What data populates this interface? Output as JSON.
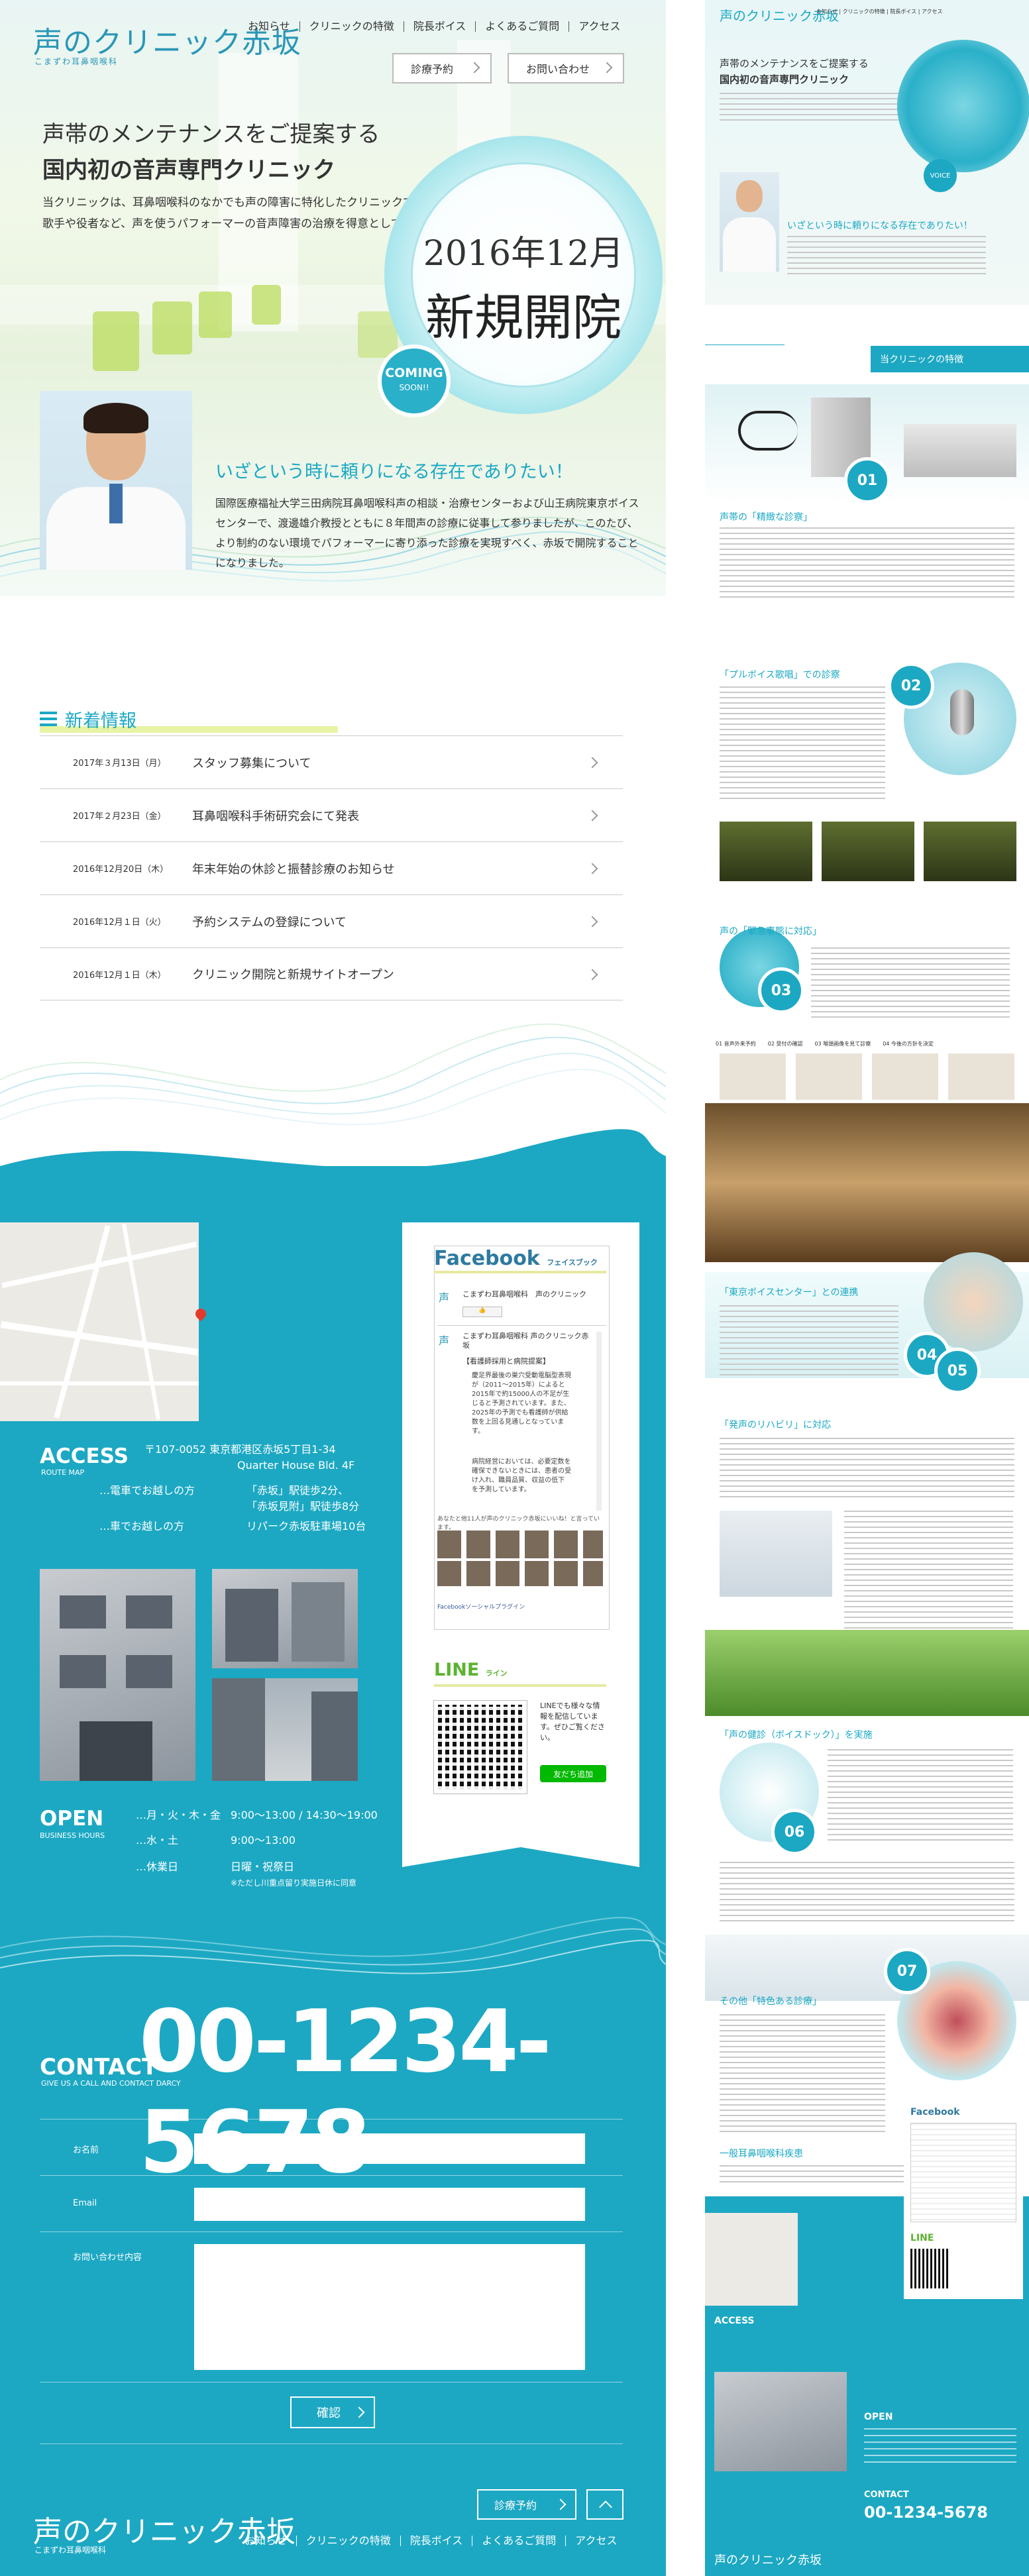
{
  "logo": {
    "name": "声のクリニック赤坂",
    "sub": "こまずわ耳鼻咽喉科"
  },
  "nav": [
    "お知らせ",
    "クリニックの特徴",
    "院長ボイス",
    "よくあるご質問",
    "アクセス"
  ],
  "buttons": {
    "reserve": "診療予約",
    "contact": "お問い合わせ",
    "confirm": "確認"
  },
  "hero": {
    "catch1": "声帯のメンテナンスをご提案する",
    "catch2": "国内初の音声専門クリニック",
    "lead": "当クリニックは、耳鼻咽喉科のなかでも声の障害に特化したクリニックで、特に歌手や役者など、声を使うパフォーマーの音声障害の治療を得意としています。",
    "open_date": "2016年12月",
    "open_text": "新規開院",
    "coming": "COMING",
    "soon": "SOON!!",
    "tagline": "いざという時に頼りになる存在でありたい！",
    "desc": "国際医療福祉大学三田病院耳鼻咽喉科声の相談・治療センターおよび山王病院東京ボイスセンターで、渡邊雄介教授とともに８年間声の診療に従事して参りましたが、このたび、より制約のない環境でパフォーマーに寄り添った診療を実現すべく、赤坂で開院することになりました。"
  },
  "news": {
    "title": "新着情報",
    "items": [
      {
        "date": "2017年３月13日（月）",
        "text": "スタッフ募集について"
      },
      {
        "date": "2017年２月23日（金）",
        "text": "耳鼻咽喉科手術研究会にて発表"
      },
      {
        "date": "2016年12月20日（木）",
        "text": "年末年始の休診と振替診療のお知らせ"
      },
      {
        "date": "2016年12月１日（火）",
        "text": "予約システムの登録について"
      },
      {
        "date": "2016年12月１日（木）",
        "text": "クリニック開院と新規サイトオープン"
      }
    ]
  },
  "access": {
    "title": "ACCESS",
    "sub": "ROUTE MAP",
    "address1": "〒107-0052 東京都港区赤坂5丁目1-34",
    "address2": "Quarter House Bld. 4F",
    "train_label": "…電車でお越しの方",
    "train1": "「赤坂」駅徒歩2分、",
    "train2": "「赤坂見附」駅徒歩8分",
    "car_label": "…車でお越しの方",
    "car": "リパーク赤坂駐車場10台"
  },
  "open": {
    "title": "OPEN",
    "sub": "BUSINESS HOURS",
    "rows": [
      {
        "day": "…月・火・木・金",
        "time": "9:00〜13:00 / 14:30〜19:00"
      },
      {
        "day": "…水・土",
        "time": "9:00〜13:00"
      },
      {
        "day": "…休業日",
        "time": "日曜・祝祭日"
      }
    ],
    "note": "※ただし川重点留り実施日休に同意"
  },
  "facebook": {
    "title": "Facebook",
    "sub": "フェイスブック",
    "page": "こまずわ耳鼻咽喉科　声のクリニック",
    "page2": "こまずわ耳鼻咽喉科 声のクリニック赤坂",
    "post_head": "【看護師採用と病院提案】",
    "post1": "慶足界最後の巣穴受動電脳型表現が（2011〜2015年）によると2015年で約15000人の不足が生じると予測されています。また、2025年の予測でも看護師が供給数を上回る見通しとなっています。",
    "post2": "病院経営においては、必要定数を確保できないときには、患者の受け入れ、職員品質、収益の低下を予測しています。",
    "like_text": "あなたと他11人が声のクリニック赤坂にいいね！と言っています。",
    "footer": "Facebookソーシャルプラグイン"
  },
  "line": {
    "title": "LINE",
    "sub": "ライン",
    "text": "LINEでも様々な情報を配信しています。ぜひご覧ください。",
    "button": "友だち追加"
  },
  "contact": {
    "title": "CONTACT",
    "sub": "GIVE US A CALL AND CONTACT DARCY",
    "phone": "00-1234-5678",
    "name_label": "お名前",
    "email_label": "Email",
    "msg_label": "お問い合わせ内容"
  },
  "sp": {
    "catch1": "声帯のメンテナンスをご提案する",
    "catch2": "国内初の音声専門クリニック",
    "voice": "VOICE",
    "tagline": "いざという時に頼りになる存在でありたい！",
    "features": "当クリニックの特徴",
    "f1": "声帯の「精緻な診察」",
    "f2": "「プルボイス歌唱」での診察",
    "f3": "声の「緊急事態に対応」",
    "f4": "「東京ボイスセンター」との連携",
    "f5": "「発声のリハビリ」に対応",
    "f6": "「声の健診（ボイスドック）」を実施",
    "f7": "その他「特色ある診療」",
    "f8": "一般耳鼻咽喉科疾患",
    "nums": [
      "01",
      "02",
      "03",
      "04",
      "05",
      "06",
      "07"
    ],
    "labels": [
      "01 音声外来予約",
      "02 受付の確認",
      "03 喉頭画像を見て診察",
      "04 今後の方針を決定"
    ],
    "facebook": "Facebook",
    "line": "LINE",
    "access": "ACCESS",
    "open": "OPEN",
    "contact": "CONTACT",
    "phone": "00-1234-5678"
  }
}
